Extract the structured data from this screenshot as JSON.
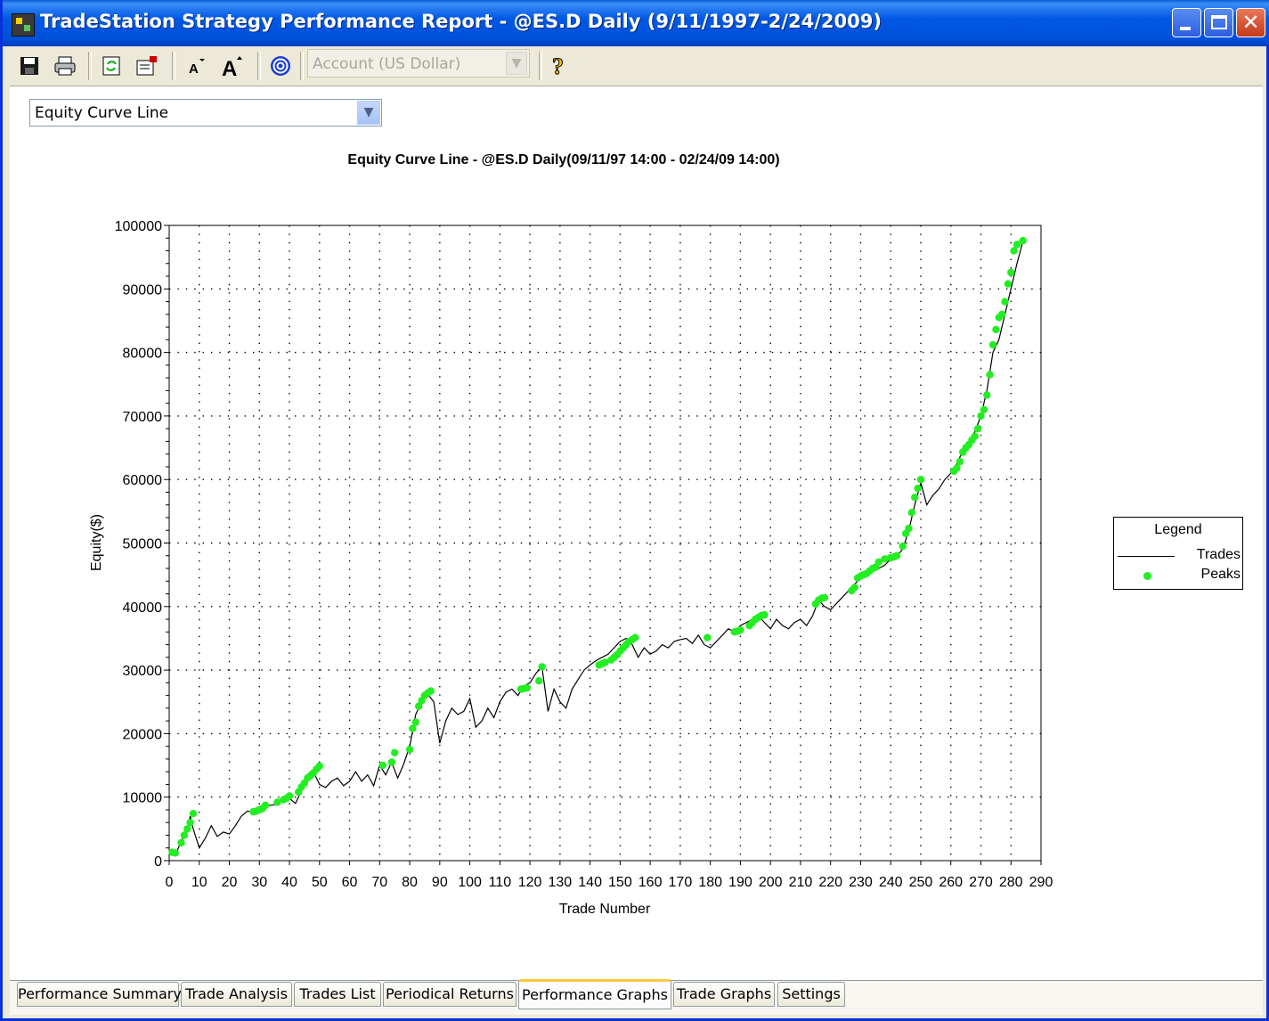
{
  "window": {
    "title": "TradeStation Strategy Performance Report - @ES.D Daily (9/11/1997-2/24/2009)",
    "close_glyph": "✕"
  },
  "toolbar": {
    "account_placeholder": "Account (US Dollar)",
    "help_glyph": "?"
  },
  "view_selector": {
    "value": "Equity Curve Line"
  },
  "legend": {
    "title": "Legend",
    "trades_label": "Trades",
    "peaks_label": "Peaks"
  },
  "tabs": [
    {
      "label": "Performance Summary",
      "active": false
    },
    {
      "label": "Trade Analysis",
      "active": false
    },
    {
      "label": "Trades List",
      "active": false
    },
    {
      "label": "Periodical Returns",
      "active": false
    },
    {
      "label": "Performance Graphs",
      "active": true
    },
    {
      "label": "Trade Graphs",
      "active": false
    },
    {
      "label": "Settings",
      "active": false
    }
  ],
  "colors": {
    "peaks": "#22ee22",
    "trades": "#000000",
    "title_bar": "#0058e6",
    "active_tab_accent": "#ffc83c"
  },
  "chart_data": {
    "type": "line",
    "title": "Equity Curve Line - @ES.D Daily(09/11/97 14:00 - 02/24/09 14:00)",
    "xlabel": "Trade Number",
    "ylabel": "Equity($)",
    "xlim": [
      0,
      290
    ],
    "ylim": [
      0,
      100000
    ],
    "x_ticks": [
      "0",
      "10",
      "20",
      "30",
      "40",
      "50",
      "60",
      "70",
      "80",
      "90",
      "100",
      "110",
      "120",
      "130",
      "140",
      "150",
      "160",
      "170",
      "180",
      "190",
      "200",
      "210",
      "220",
      "230",
      "240",
      "250",
      "260",
      "270",
      "280",
      "290"
    ],
    "y_ticks": [
      "0",
      "10000",
      "20000",
      "30000",
      "40000",
      "50000",
      "60000",
      "70000",
      "80000",
      "90000",
      "100000"
    ],
    "grid": true,
    "legend_position": "right",
    "series": [
      {
        "name": "Trades",
        "x": [
          0,
          2,
          4,
          6,
          7,
          8,
          10,
          12,
          14,
          16,
          18,
          20,
          22,
          24,
          26,
          28,
          30,
          32,
          35,
          38,
          40,
          42,
          44,
          46,
          48,
          50,
          52,
          54,
          56,
          58,
          60,
          62,
          64,
          66,
          68,
          70,
          72,
          74,
          76,
          78,
          80,
          82,
          84,
          86,
          88,
          90,
          92,
          94,
          96,
          98,
          100,
          102,
          104,
          106,
          108,
          110,
          112,
          114,
          116,
          118,
          120,
          122,
          124,
          126,
          128,
          130,
          132,
          134,
          136,
          138,
          140,
          142,
          144,
          146,
          148,
          150,
          152,
          154,
          156,
          158,
          160,
          162,
          164,
          166,
          168,
          170,
          172,
          174,
          176,
          178,
          180,
          182,
          184,
          186,
          188,
          190,
          192,
          194,
          196,
          198,
          200,
          202,
          204,
          206,
          208,
          210,
          212,
          214,
          216,
          218,
          220,
          222,
          224,
          226,
          228,
          230,
          232,
          234,
          236,
          238,
          240,
          242,
          244,
          246,
          248,
          250,
          252,
          254,
          256,
          258,
          260,
          262,
          264,
          266,
          268,
          270,
          272,
          274,
          276,
          278,
          280,
          282,
          284
        ],
        "y": [
          1000,
          900,
          3000,
          5000,
          7000,
          5000,
          2000,
          3500,
          5500,
          3800,
          4500,
          4200,
          5500,
          7000,
          7800,
          7600,
          8000,
          8600,
          8800,
          9500,
          9800,
          9000,
          11000,
          12500,
          14000,
          12000,
          11500,
          12500,
          13000,
          11800,
          12500,
          14000,
          12500,
          13500,
          11800,
          15000,
          13500,
          15500,
          13000,
          15200,
          18000,
          23000,
          25000,
          26200,
          25000,
          18500,
          22000,
          24000,
          23000,
          23500,
          25500,
          21000,
          22000,
          24000,
          22500,
          25000,
          26500,
          27000,
          26000,
          27500,
          28000,
          29500,
          30500,
          23500,
          27000,
          25000,
          24000,
          27000,
          28500,
          30000,
          30800,
          31500,
          32000,
          32500,
          33500,
          34500,
          35000,
          34000,
          32000,
          33500,
          32500,
          33000,
          34000,
          33500,
          34500,
          34800,
          35000,
          34200,
          35500,
          34000,
          33500,
          34500,
          35500,
          36500,
          36000,
          37000,
          37500,
          38000,
          38500,
          37500,
          36500,
          38000,
          37000,
          36500,
          37500,
          38000,
          37000,
          38500,
          41000,
          40000,
          39500,
          40500,
          41500,
          42500,
          43500,
          44500,
          45000,
          45500,
          46000,
          46500,
          47500,
          48000,
          49000,
          52000,
          56000,
          59500,
          56000,
          57500,
          58500,
          60000,
          61000,
          62500,
          64500,
          66000,
          67500,
          70000,
          74000,
          80000,
          82000,
          86000,
          90000,
          94000,
          97500
        ]
      },
      {
        "name": "Peaks",
        "x": [
          1,
          2,
          4,
          5,
          6,
          7,
          8,
          28,
          29,
          30,
          31,
          32,
          36,
          38,
          39,
          40,
          43,
          44,
          45,
          46,
          47,
          48,
          49,
          50,
          71,
          74,
          75,
          80,
          81,
          82,
          83,
          84,
          85,
          86,
          87,
          117,
          118,
          119,
          123,
          124,
          143,
          144,
          145,
          147,
          148,
          149,
          150,
          151,
          152,
          153,
          154,
          155,
          179,
          188,
          189,
          190,
          193,
          194,
          195,
          196,
          197,
          198,
          215,
          216,
          217,
          218,
          227,
          228,
          229,
          230,
          231,
          232,
          233,
          234,
          235,
          236,
          238,
          240,
          241,
          242,
          244,
          245,
          246,
          247,
          248,
          249,
          250,
          261,
          262,
          263,
          264,
          265,
          266,
          267,
          268,
          269,
          270,
          271,
          272,
          273,
          274,
          275,
          276,
          277,
          278,
          279,
          280,
          281,
          282,
          284
        ],
        "y": [
          1300,
          1200,
          2800,
          4000,
          5000,
          6000,
          7400,
          7700,
          7800,
          8000,
          8200,
          8700,
          9200,
          9600,
          9800,
          10200,
          10800,
          11600,
          12200,
          13000,
          13400,
          13800,
          14400,
          14900,
          15000,
          15500,
          17000,
          17500,
          20800,
          21800,
          24300,
          25200,
          26000,
          26400,
          26700,
          27000,
          27100,
          27200,
          28300,
          30500,
          30800,
          31000,
          31200,
          31600,
          32000,
          32400,
          33000,
          33500,
          34000,
          34500,
          34800,
          35100,
          35100,
          36000,
          36100,
          36300,
          37000,
          37500,
          38000,
          38300,
          38600,
          38700,
          40400,
          41000,
          41300,
          41400,
          42500,
          43000,
          44500,
          44800,
          45000,
          45200,
          45600,
          46000,
          46200,
          47000,
          47500,
          47700,
          47800,
          48000,
          49500,
          51500,
          52300,
          54800,
          57200,
          58600,
          60000,
          61300,
          61800,
          62800,
          64300,
          65000,
          65500,
          66200,
          66800,
          68000,
          70000,
          71000,
          73300,
          76500,
          81200,
          83600,
          85500,
          86000,
          88000,
          90800,
          92600,
          96000,
          97000,
          97600
        ]
      }
    ]
  }
}
